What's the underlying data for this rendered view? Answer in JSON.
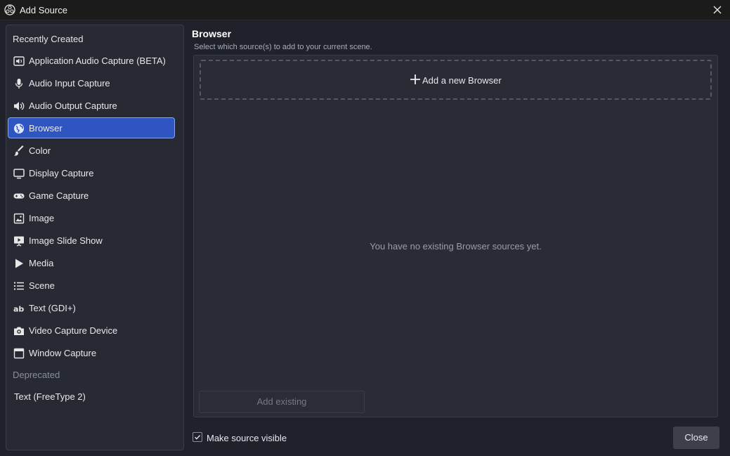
{
  "window": {
    "title": "Add Source",
    "icon": "obs-logo-icon",
    "close_icon": "close-icon"
  },
  "sidebar": {
    "recent_heading": "Recently Created",
    "items": [
      {
        "label": "Application Audio Capture (BETA)",
        "icon": "speaker-box-icon",
        "selected": false
      },
      {
        "label": "Audio Input Capture",
        "icon": "microphone-icon",
        "selected": false
      },
      {
        "label": "Audio Output Capture",
        "icon": "speaker-icon",
        "selected": false
      },
      {
        "label": "Browser",
        "icon": "globe-icon",
        "selected": true
      },
      {
        "label": "Color",
        "icon": "paintbrush-icon",
        "selected": false
      },
      {
        "label": "Display Capture",
        "icon": "monitor-icon",
        "selected": false
      },
      {
        "label": "Game Capture",
        "icon": "gamepad-icon",
        "selected": false
      },
      {
        "label": "Image",
        "icon": "image-icon",
        "selected": false
      },
      {
        "label": "Image Slide Show",
        "icon": "slideshow-icon",
        "selected": false
      },
      {
        "label": "Media",
        "icon": "play-icon",
        "selected": false
      },
      {
        "label": "Scene",
        "icon": "list-icon",
        "selected": false
      },
      {
        "label": "Text (GDI+)",
        "icon": "text-ab-icon",
        "selected": false
      },
      {
        "label": "Video Capture Device",
        "icon": "camera-icon",
        "selected": false
      },
      {
        "label": "Window Capture",
        "icon": "window-icon",
        "selected": false
      }
    ],
    "deprecated_heading": "Deprecated",
    "deprecated_items": [
      {
        "label": "Text (FreeType 2)"
      }
    ]
  },
  "main": {
    "title": "Browser",
    "subtitle": "Select which source(s) to add to your current scene.",
    "add_new_label": "Add a new Browser",
    "empty_message": "You have no existing Browser sources yet.",
    "add_existing_label": "Add existing"
  },
  "footer": {
    "visible_label": "Make source visible",
    "visible_checked": true,
    "close_label": "Close"
  },
  "colors": {
    "background": "#1f212b",
    "selected": "#2f55c0",
    "selected_border": "#8aa4f0"
  }
}
